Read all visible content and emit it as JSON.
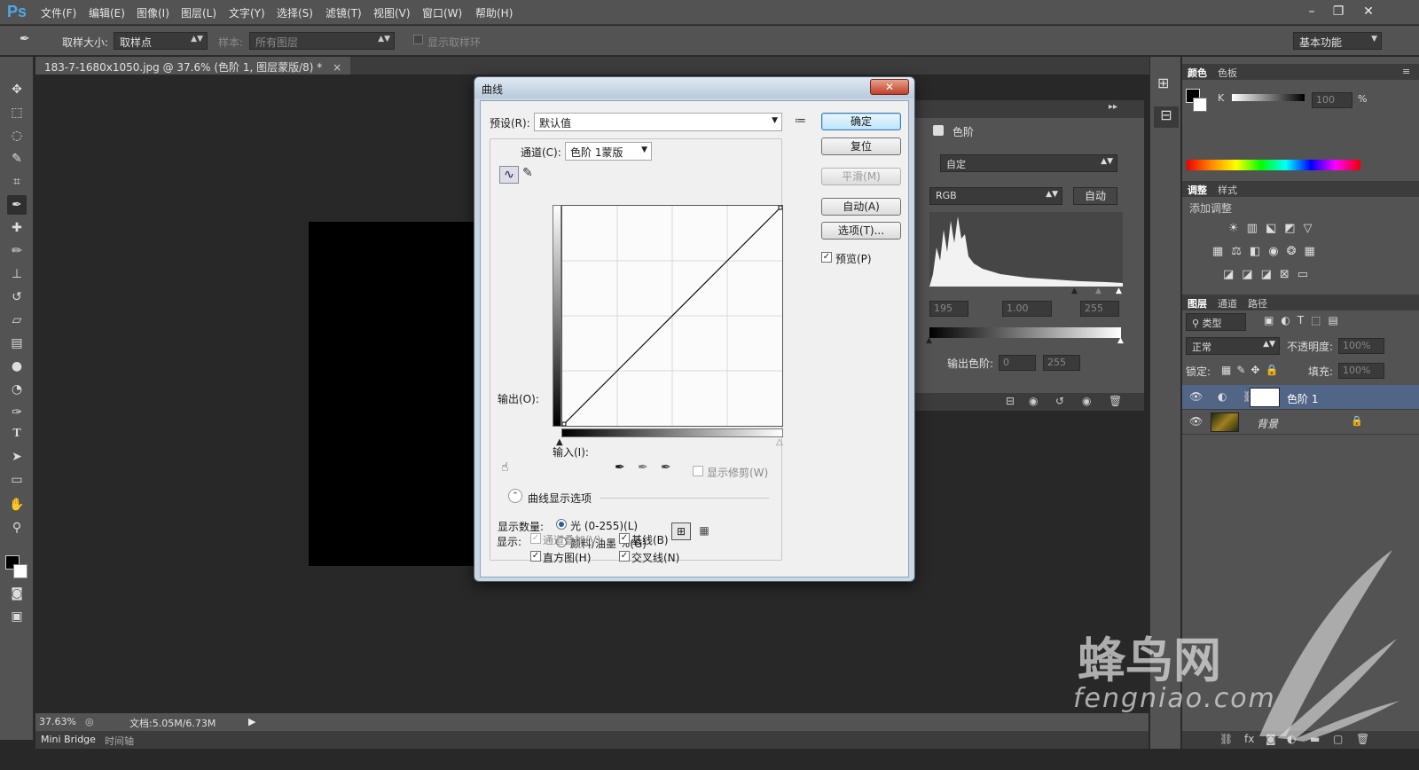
{
  "app": {
    "logo": "Ps",
    "menu": [
      "文件(F)",
      "编辑(E)",
      "图像(I)",
      "图层(L)",
      "文字(Y)",
      "选择(S)",
      "滤镜(T)",
      "视图(V)",
      "窗口(W)",
      "帮助(H)"
    ],
    "window_controls": {
      "minimize": "–",
      "restore": "❐",
      "close": "✕"
    }
  },
  "options_bar": {
    "sample_size_label": "取样大小:",
    "sample_size_value": "取样点",
    "sample_label": "样本:",
    "sample_value": "所有图层",
    "show_ring_label": "显示取样环",
    "workspace": "基本功能"
  },
  "document": {
    "tab_title": "183-7-1680x1050.jpg @ 37.6% (色阶 1, 图层蒙版/8) *",
    "zoom": "37.63%",
    "doc_size": "文档:5.05M/6.73M"
  },
  "bottom_tabs": [
    "Mini Bridge",
    "时间轴"
  ],
  "properties_panel": {
    "title": "色阶",
    "preset": "自定",
    "channel": "RGB",
    "auto_label": "自动",
    "input_values": [
      "195",
      "1.00",
      "255"
    ],
    "output_label": "输出色阶:",
    "output_values": [
      "0",
      "255"
    ]
  },
  "color_panel": {
    "tabs": [
      "颜色",
      "色板"
    ],
    "channel_label": "K",
    "value": "100",
    "unit": "%"
  },
  "adjustments_panel": {
    "tabs": [
      "调整",
      "样式"
    ],
    "title": "添加调整"
  },
  "layers_panel": {
    "tabs": [
      "图层",
      "通道",
      "路径"
    ],
    "filter_label": "类型",
    "blend_mode": "正常",
    "opacity_label": "不透明度:",
    "opacity_value": "100%",
    "lock_label": "锁定:",
    "fill_label": "填充:",
    "fill_value": "100%",
    "layers": [
      {
        "name": "色阶 1",
        "selected": true
      },
      {
        "name": "背景",
        "selected": false
      }
    ]
  },
  "dialog": {
    "title": "曲线",
    "close": "✕",
    "preset_label": "预设(R):",
    "preset_value": "默认值",
    "channel_label": "通道(C):",
    "channel_value": "色阶 1蒙版",
    "output_label": "输出(O):",
    "input_label": "输入(I):",
    "show_clipping_label": "显示修剪(W)",
    "curve_options_label": "曲线显示选项",
    "show_amount_label": "显示数量:",
    "light_option": "光 (0-255)(L)",
    "pigment_option": "颜料/油墨 %(G)",
    "show_label": "显示:",
    "channel_overlay": "通道叠加(V)",
    "baseline": "基线(B)",
    "histogram": "直方图(H)",
    "intersection": "交叉线(N)",
    "buttons": {
      "ok": "确定",
      "reset": "复位",
      "smooth": "平滑(M)",
      "auto": "自动(A)",
      "options": "选项(T)..."
    },
    "preview_label": "预览(P)"
  },
  "watermark": {
    "brand": "蜂鸟网",
    "domain": "fengniao.com"
  }
}
